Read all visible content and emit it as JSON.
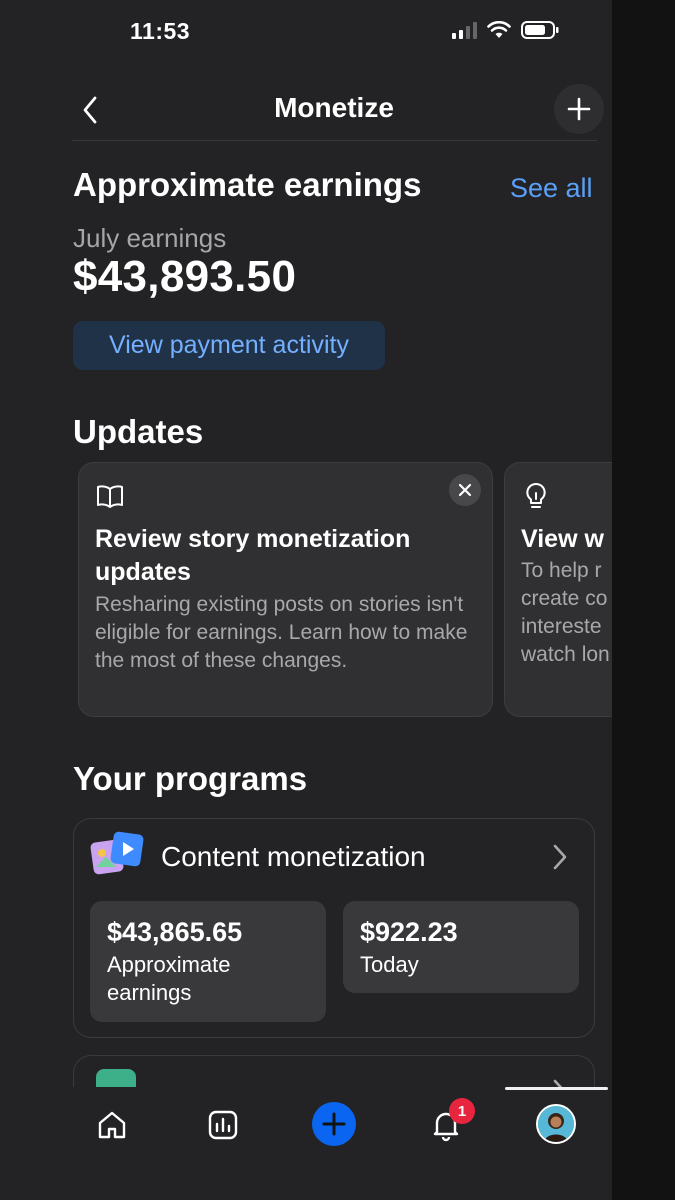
{
  "status_bar": {
    "time": "11:53"
  },
  "header": {
    "title": "Monetize"
  },
  "earnings": {
    "heading": "Approximate earnings",
    "see_all": "See all",
    "period_label": "July earnings",
    "amount": "$43,893.50",
    "payment_button": "View payment activity"
  },
  "updates": {
    "heading": "Updates",
    "cards": [
      {
        "title": "Review story monetization updates",
        "description": "Resharing existing posts on stories isn't eligible for earnings. Learn how to make the most of these changes."
      },
      {
        "title": "View w",
        "description_lines": [
          "To help r",
          "create co",
          "intereste",
          "watch lon"
        ]
      }
    ]
  },
  "programs": {
    "heading": "Your programs",
    "items": [
      {
        "title": "Content monetization",
        "stats": [
          {
            "value": "$43,865.65",
            "label": "Approximate earnings"
          },
          {
            "value": "$922.23",
            "label": "Today"
          }
        ]
      }
    ]
  },
  "tab_bar": {
    "items": [
      "home-icon",
      "insights-icon",
      "create-icon",
      "notifications-icon",
      "profile-avatar"
    ],
    "notification_count": "1"
  },
  "colors": {
    "accent": "#5aa0f8",
    "create_button": "#0a66f0",
    "badge": "#e8253f"
  }
}
